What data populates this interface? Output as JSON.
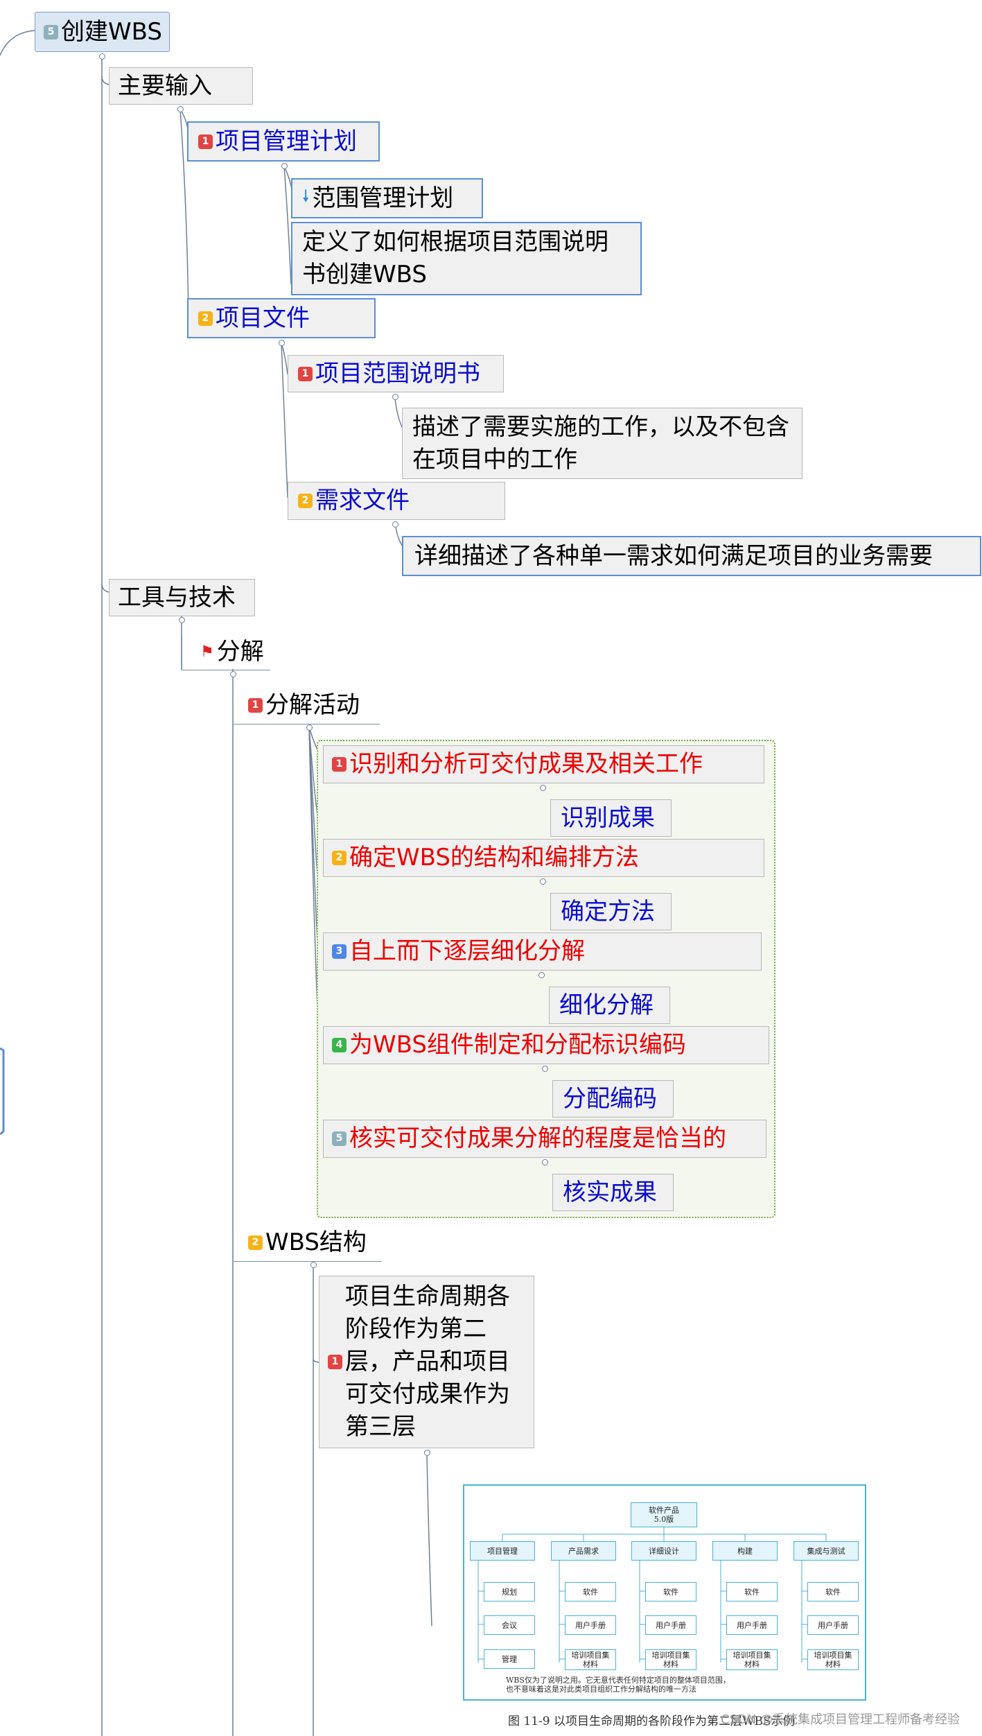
{
  "root": {
    "badge": "5",
    "label": "创建WBS"
  },
  "inputs": {
    "label": "主要输入",
    "pm_plan": {
      "badge": "1",
      "label": "项目管理计划",
      "scope_plan": {
        "label": "范围管理计划",
        "desc": "定义了如何根据项目范围说明书创建WBS"
      }
    },
    "project_docs": {
      "badge": "2",
      "label": "项目文件",
      "scope_statement": {
        "badge": "1",
        "label": "项目范围说明书",
        "desc": "描述了需要实施的工作，以及不包含在项目中的工作"
      },
      "requirements": {
        "badge": "2",
        "label": "需求文件",
        "desc": "详细描述了各种单一需求如何满足项目的业务需要"
      }
    }
  },
  "tools": {
    "label": "工具与技术",
    "decomposition": {
      "label": "分解",
      "activities": {
        "badge": "1",
        "label": "分解活动",
        "steps": [
          {
            "badge": "1",
            "label": "识别和分析可交付成果及相关工作",
            "note": "识别成果"
          },
          {
            "badge": "2",
            "label": "确定WBS的结构和编排方法",
            "note": "确定方法"
          },
          {
            "badge": "3",
            "label": "自上而下逐层细化分解",
            "note": "细化分解"
          },
          {
            "badge": "4",
            "label": "为WBS组件制定和分配标识编码",
            "note": "分配编码"
          },
          {
            "badge": "5",
            "label": "核实可交付成果分解的程度是恰当的",
            "note": "核实成果"
          }
        ]
      },
      "wbs_structure": {
        "badge": "2",
        "label": "WBS结构",
        "item": {
          "badge": "1",
          "line1": "项目生命周期各",
          "line2": "阶段作为第二",
          "line3": "层，产品和项目",
          "line4": "可交付成果作为",
          "line5": "第三层"
        }
      }
    }
  },
  "figure": {
    "top": {
      "line1": "软件产品",
      "line2": "5.0版"
    },
    "columns": [
      {
        "head": "项目管理",
        "items": [
          "规划",
          "会议",
          "管理"
        ]
      },
      {
        "head": "产品需求",
        "items": [
          "软件",
          "用户手册",
          "培训项目集材料"
        ]
      },
      {
        "head": "详细设计",
        "items": [
          "软件",
          "用户手册",
          "培训项目集材料"
        ]
      },
      {
        "head": "构建",
        "items": [
          "软件",
          "用户手册",
          "培训项目集材料"
        ]
      },
      {
        "head": "集成与测试",
        "items": [
          "软件",
          "用户手册",
          "培训项目集材料"
        ]
      }
    ],
    "note_line1": "WBS仅为了说明之用。它无意代表任何特定项目的整体项目范围，",
    "note_line2": "也不意味着这是对此类项目组织工作分解结构的唯一方法",
    "caption": "图 11-9 以项目生命周期的各阶段作为第二层WBS示例",
    "watermark": "CSDN @系统集成项目管理工程师备考经验"
  },
  "colors": {
    "connector": "#6d7f99",
    "node_border_blue": "#5b8fd6",
    "text_blue": "#0b0bd0",
    "text_red": "#ee0000",
    "group_border": "#7aa84a"
  }
}
